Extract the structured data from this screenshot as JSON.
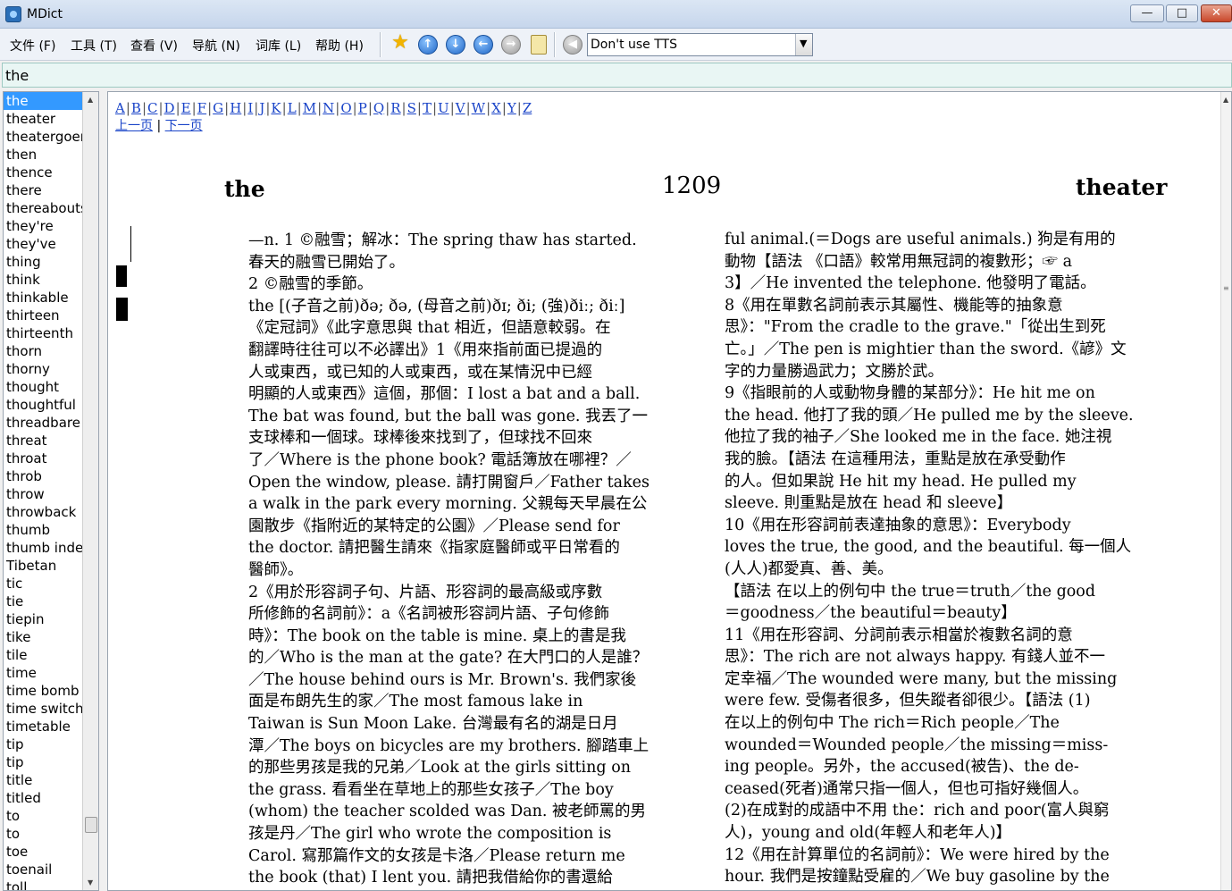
{
  "window": {
    "title": "MDict",
    "min_glyph": "—",
    "max_glyph": "□",
    "close_glyph": "✕"
  },
  "menu": [
    "文件 (F)",
    "工具 (T)",
    "查看 (V)",
    "导航 (N)",
    "词库 (L)",
    "帮助 (H)"
  ],
  "toolbar": {
    "favorite_glyph": "★",
    "up_glyph": "↑",
    "down_glyph": "↓",
    "back_glyph": "←",
    "forward_glyph": "→",
    "speak_glyph": "◀",
    "tts_value": "Don't use TTS",
    "tts_arrow": "▼"
  },
  "search": {
    "value": "the"
  },
  "wordlist": {
    "selected_index": 0,
    "items": [
      "the",
      "theater",
      "theatergoer",
      "then",
      "thence",
      "there",
      "thereabouts",
      "they're",
      "they've",
      "thing",
      "think",
      "thinkable",
      "thirteen",
      "thirteenth",
      "thorn",
      "thorny",
      "thought",
      "thoughtful",
      "threadbare",
      "threat",
      "throat",
      "throb",
      "throw",
      "throwback",
      "thumb",
      "thumb index",
      "Tibetan",
      "tic",
      "tie",
      "tiepin",
      "tike",
      "tile",
      "time",
      "time bomb",
      "time switch",
      "timetable",
      "tip",
      "tip",
      "title",
      "titled",
      "to",
      "to",
      "toe",
      "toenail",
      "toll"
    ],
    "up_glyph": "▲",
    "down_glyph": "▼",
    "thumb_glyph": "≡"
  },
  "content": {
    "letters": [
      "A",
      "B",
      "C",
      "D",
      "E",
      "F",
      "G",
      "H",
      "I",
      "J",
      "K",
      "L",
      "M",
      "N",
      "O",
      "P",
      "Q",
      "R",
      "S",
      "T",
      "U",
      "V",
      "W",
      "X",
      "Y",
      "Z"
    ],
    "separator": "|",
    "prev_page": "上一页",
    "next_page": "下一页",
    "page_header": {
      "left": "the",
      "center": "1209",
      "right": "theater"
    },
    "scroll_up_glyph": "▲",
    "scroll_grip_glyph": "≡",
    "left_column": [
      "—n. 1 ©融雪；解冰：The spring thaw has started.",
      "春天的融雪已開始了。",
      "2 ©融雪的季節。",
      "the [(子音之前)ðə; ðə, (母音之前)ðɪ; ði; (強)ðiː; ðiː]",
      "《定冠詞》《此字意思與 that 相近，但語意較弱。在",
      "翻譯時往往可以不必譯出》1《用來指前面已提過的",
      "人或東西，或已知的人或東西，或在某情況中已經",
      "明顯的人或東西》這個，那個：I lost a bat and a ball.",
      "The bat was found, but the ball was gone. 我丟了一",
      "支球棒和一個球。球棒後來找到了，但球找不回來",
      "了／Where is the phone book? 電話簿放在哪裡？／",
      "Open the window, please. 請打開窗戶／Father takes",
      "a walk in the park every morning. 父親每天早晨在公",
      "園散步《指附近的某特定的公園》／Please send for",
      "the doctor. 請把醫生請來《指家庭醫師或平日常看的",
      "醫師》。",
      "2《用於形容詞子句、片語、形容詞的最高級或序數",
      "所修飾的名詞前》：a《名詞被形容詞片語、子句修飾",
      "時》：The book on the table is mine. 桌上的書是我",
      "的／Who is the man at the gate? 在大門口的人是誰？",
      "／The house behind ours is Mr. Brown's. 我們家後",
      "面是布朗先生的家／The most famous lake in",
      "Taiwan is Sun Moon Lake. 台灣最有名的湖是日月",
      "潭／The boys on bicycles are my brothers. 腳踏車上",
      "的那些男孩是我的兄弟／Look at the girls sitting on",
      "the grass. 看看坐在草地上的那些女孩子／The boy",
      "(whom) the teacher scolded was Dan. 被老師罵的男",
      "孩是丹／The girl who wrote the composition is",
      "Carol. 寫那篇作文的女孩是卡洛／Please return me",
      "the book (that) I lent you. 請把我借給你的書還給"
    ],
    "right_column": [
      "ful animal.(＝Dogs are useful animals.) 狗是有用的",
      "動物【語法 《口語》較常用無冠詞的複數形；☞ a",
      "3】／He invented the telephone. 他發明了電話。",
      "8《用在單數名詞前表示其屬性、機能等的抽象意",
      "思》：\"From the cradle to the grave.\"「從出生到死",
      "亡。」／The pen is mightier than the sword.《諺》文",
      "字的力量勝過武力；文勝於武。",
      "9《指眼前的人或動物身體的某部分》：He hit me on",
      "the head. 他打了我的頭／He pulled me by the sleeve.",
      "他拉了我的袖子／She looked me in the face. 她注視",
      "我的臉。【語法 在這種用法，重點是放在承受動作",
      "的人。但如果說 He hit my head. He pulled my",
      "sleeve. 則重點是放在 head 和 sleeve】",
      "10《用在形容詞前表達抽象的意思》：Everybody",
      "loves the true, the good, and the beautiful. 每一個人",
      "(人人)都愛真、善、美。",
      "【語法 在以上的例句中 the true＝truth／the good",
      "＝goodness／the beautiful＝beauty】",
      "11《用在形容詞、分詞前表示相當於複數名詞的意",
      "思》：The rich are not always happy. 有錢人並不一",
      "定幸福／The wounded were many, but the missing",
      "were few. 受傷者很多，但失蹤者卻很少。【語法 (1)",
      "在以上的例句中 The rich＝Rich people／The",
      "wounded＝Wounded people／the missing＝miss-",
      "ing people。另外，the accused(被告)、the de-",
      "ceased(死者)通常只指一個人，但也可指好幾個人。",
      "(2)在成對的成語中不用 the：rich and poor(富人與窮",
      "人)，young and old(年輕人和老年人)】",
      "12《用在計算單位的名詞前》：We were hired by the",
      "hour. 我們是按鐘點受雇的／We buy gasoline by the"
    ]
  }
}
